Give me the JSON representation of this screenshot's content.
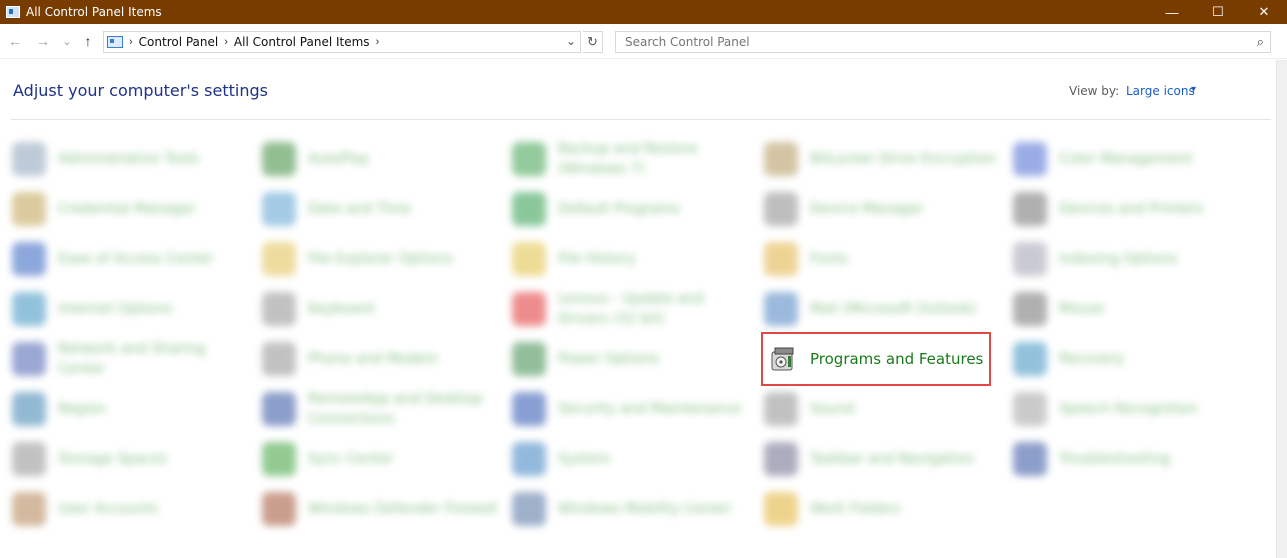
{
  "window": {
    "title": "All Control Panel Items",
    "controls": {
      "minimize": "—",
      "maximize": "☐",
      "close": "✕"
    }
  },
  "nav": {
    "back_icon": "←",
    "forward_icon": "→",
    "recent_icon": "⌄",
    "up_icon": "↑",
    "breadcrumb": [
      "Control Panel",
      "All Control Panel Items"
    ],
    "separator": "›",
    "dropdown_icon": "⌄",
    "refresh_icon": "↻"
  },
  "search": {
    "placeholder": "Search Control Panel",
    "icon": "⌕"
  },
  "header": {
    "title": "Adjust your computer's settings",
    "view_by_label": "View by:",
    "view_by_value": "Large icons",
    "view_by_caret": "▾"
  },
  "items": [
    {
      "label": "Administrative Tools",
      "color": "#8aa0b8"
    },
    {
      "label": "AutoPlay",
      "color": "#3a8a3a"
    },
    {
      "label": "Backup and Restore (Windows 7)",
      "color": "#3aa04a"
    },
    {
      "label": "BitLocker Drive Encryption",
      "color": "#b0955a"
    },
    {
      "label": "Color Management",
      "color": "#4a6ad0"
    },
    {
      "label": "Credential Manager",
      "color": "#c0a050"
    },
    {
      "label": "Date and Time",
      "color": "#5aa0d0"
    },
    {
      "label": "Default Programs",
      "color": "#2a9a4a"
    },
    {
      "label": "Device Manager",
      "color": "#8a8a8a"
    },
    {
      "label": "Devices and Printers",
      "color": "#707070"
    },
    {
      "label": "Ease of Access Center",
      "color": "#3060c0"
    },
    {
      "label": "File Explorer Options",
      "color": "#e0c050"
    },
    {
      "label": "File History",
      "color": "#e0c040"
    },
    {
      "label": "Fonts",
      "color": "#e0b040"
    },
    {
      "label": "Indexing Options",
      "color": "#a0a0b0"
    },
    {
      "label": "Internet Options",
      "color": "#3a90c0"
    },
    {
      "label": "Keyboard",
      "color": "#909090"
    },
    {
      "label": "Lenovo - Update and Drivers (32 bit)",
      "color": "#e03030"
    },
    {
      "label": "Mail (Microsoft Outlook)",
      "color": "#4a80c0"
    },
    {
      "label": "Mouse",
      "color": "#707070"
    },
    {
      "label": "Network and Sharing Center",
      "color": "#4a60b0"
    },
    {
      "label": "Phone and Modem",
      "color": "#909090"
    },
    {
      "label": "Power Options",
      "color": "#3a8a4a"
    },
    {
      "label": "Programs and Features",
      "color": "#6a6a6a"
    },
    {
      "label": "Recovery",
      "color": "#3a90c0"
    },
    {
      "label": "Region",
      "color": "#3a80b0"
    },
    {
      "label": "RemoteApp and Desktop Connections",
      "color": "#3050a0"
    },
    {
      "label": "Security and Maintenance",
      "color": "#2a50b0"
    },
    {
      "label": "Sound",
      "color": "#909090"
    },
    {
      "label": "Speech Recognition",
      "color": "#a0a0a0"
    },
    {
      "label": "Storage Spaces",
      "color": "#909090"
    },
    {
      "label": "Sync Center",
      "color": "#3aa03a"
    },
    {
      "label": "System",
      "color": "#3a80c0"
    },
    {
      "label": "Taskbar and Navigation",
      "color": "#6a6a8a"
    },
    {
      "label": "Troubleshooting",
      "color": "#3050a0"
    },
    {
      "label": "User Accounts",
      "color": "#b08050"
    },
    {
      "label": "Windows Defender Firewall",
      "color": "#a05030"
    },
    {
      "label": "Windows Mobility Center",
      "color": "#5070a0"
    },
    {
      "label": "Work Folders",
      "color": "#e0b030"
    }
  ]
}
